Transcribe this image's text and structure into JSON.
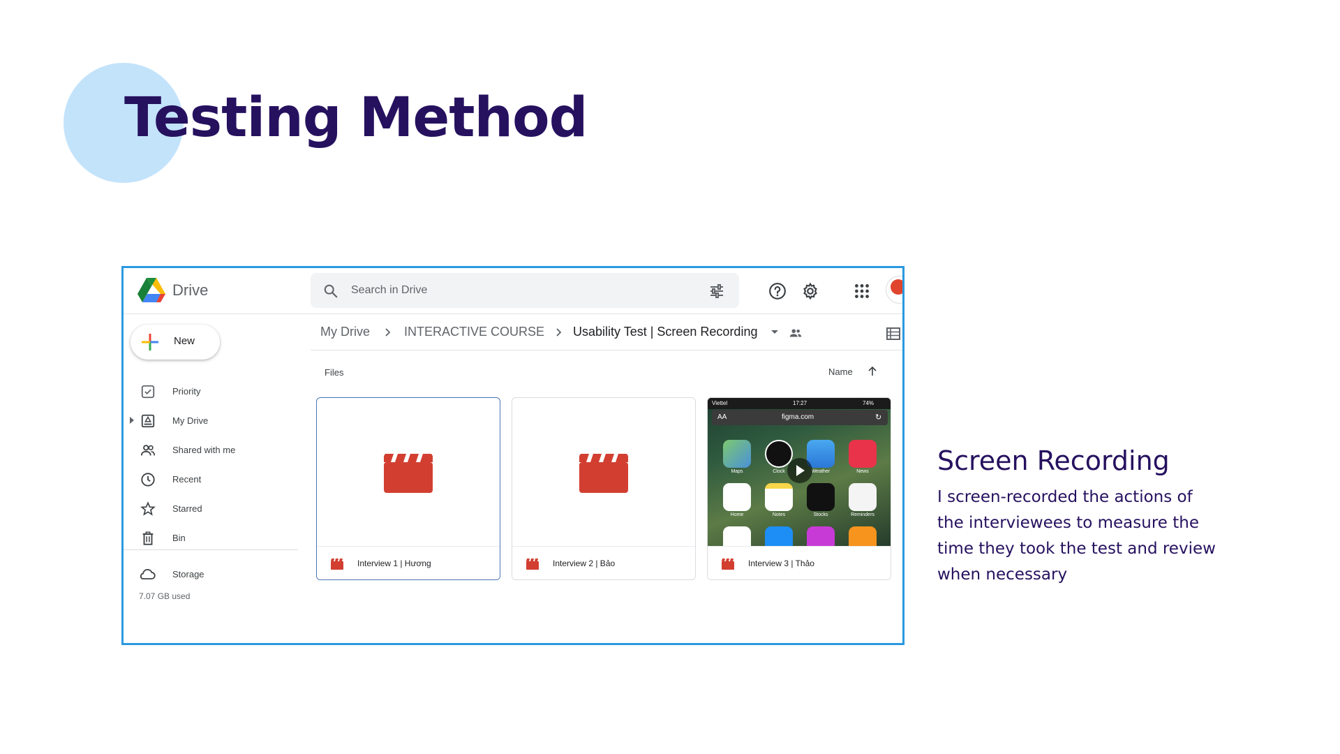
{
  "slide": {
    "title": "Testing Method",
    "right_heading": "Screen Recording",
    "right_body": "I screen-recorded the actions of the interviewees to measure the time they took the test and review when necessary"
  },
  "drive": {
    "app_name": "Drive",
    "search_placeholder": "Search in Drive",
    "new_label": "New",
    "nav": [
      {
        "label": "Priority",
        "icon": "priority-icon"
      },
      {
        "label": "My Drive",
        "icon": "my-drive-icon"
      },
      {
        "label": "Shared with me",
        "icon": "shared-icon"
      },
      {
        "label": "Recent",
        "icon": "clock-icon"
      },
      {
        "label": "Starred",
        "icon": "star-icon"
      },
      {
        "label": "Bin",
        "icon": "trash-icon"
      }
    ],
    "storage_label": "Storage",
    "storage_used": "7.07 GB used",
    "breadcrumb": [
      "My Drive",
      "INTERACTIVE COURSE",
      "Usability Test | Screen Recording"
    ],
    "files_label": "Files",
    "sort_label": "Name",
    "files": [
      {
        "name": "Interview 1 | Hương"
      },
      {
        "name": "Interview 2 | Bảo"
      },
      {
        "name": "Interview 3 | Thảo"
      }
    ],
    "phone": {
      "carrier": "Viettel",
      "time": "17:27",
      "battery": "74%",
      "aa": "AA",
      "url": "figma.com",
      "apps": [
        "Maps",
        "Clock",
        "Weather",
        "News",
        "Home",
        "Notes",
        "Stocks",
        "Reminders"
      ]
    }
  },
  "colors": {
    "title": "#26115f",
    "accent_circle": "#c3e3fb",
    "frame_border": "#2a9ae0",
    "file_icon": "#d23f31"
  }
}
